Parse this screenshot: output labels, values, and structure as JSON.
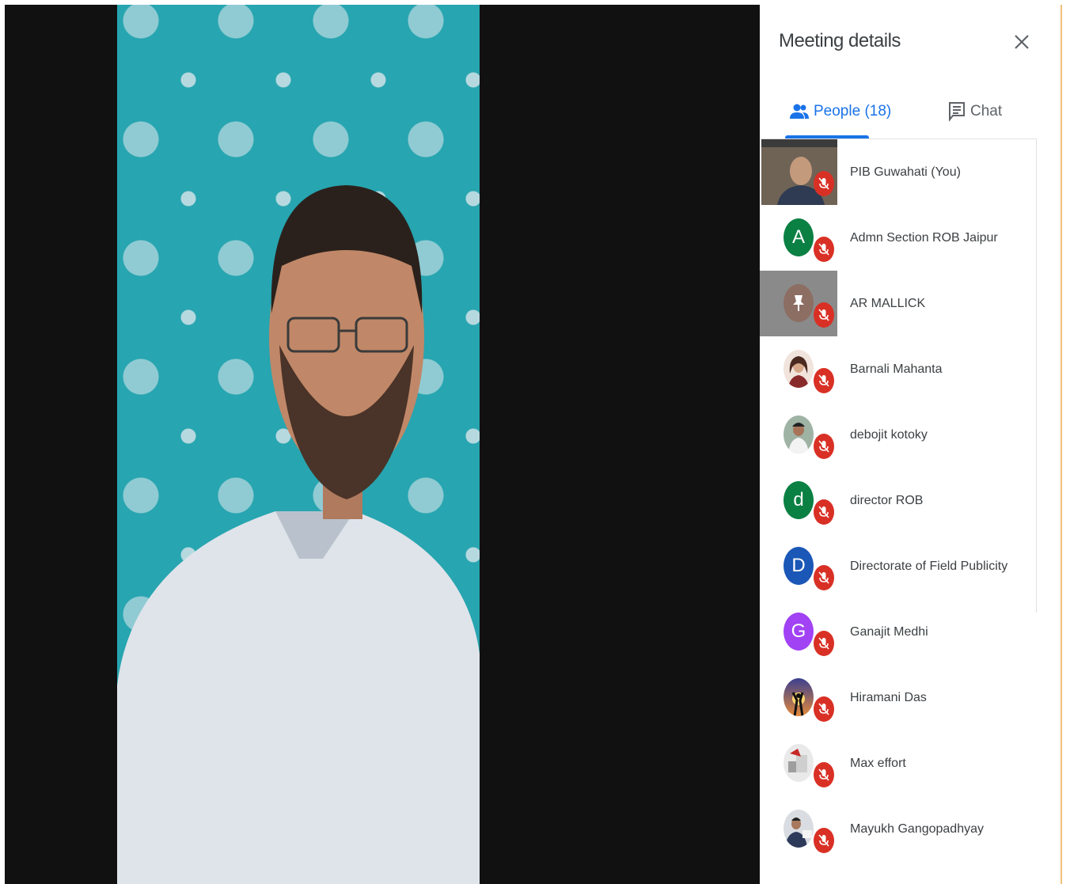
{
  "panel": {
    "title": "Meeting details",
    "tabs": [
      {
        "label": "People (18)",
        "icon": "people-icon",
        "active": true
      },
      {
        "label": "Chat",
        "icon": "chat-icon",
        "active": false
      }
    ]
  },
  "participants": [
    {
      "name": "PIB Guwahati (You)",
      "avatar": "video-thumbnail",
      "muted": true
    },
    {
      "name": "Admn Section ROB Jaipur",
      "initial": "A",
      "color": "#0b8043",
      "muted": true
    },
    {
      "name": "AR MALLICK",
      "avatar": "photo",
      "color": "#8d6e63",
      "muted": true,
      "highlighted": true
    },
    {
      "name": "Barnali Mahanta",
      "avatar": "photo",
      "muted": true
    },
    {
      "name": "debojit kotoky",
      "avatar": "photo",
      "muted": true
    },
    {
      "name": "director ROB",
      "initial": "d",
      "color": "#0b8043",
      "muted": true
    },
    {
      "name": "Directorate of Field Publicity",
      "initial": "D",
      "color": "#1a57b6",
      "muted": true
    },
    {
      "name": "Ganajit Medhi",
      "initial": "G",
      "color": "#a142f4",
      "muted": true
    },
    {
      "name": "Hiramani Das",
      "avatar": "photo",
      "muted": true
    },
    {
      "name": "Max effort",
      "avatar": "photo",
      "muted": true
    },
    {
      "name": "Mayukh Gangopadhyay",
      "avatar": "photo",
      "muted": true
    }
  ]
}
